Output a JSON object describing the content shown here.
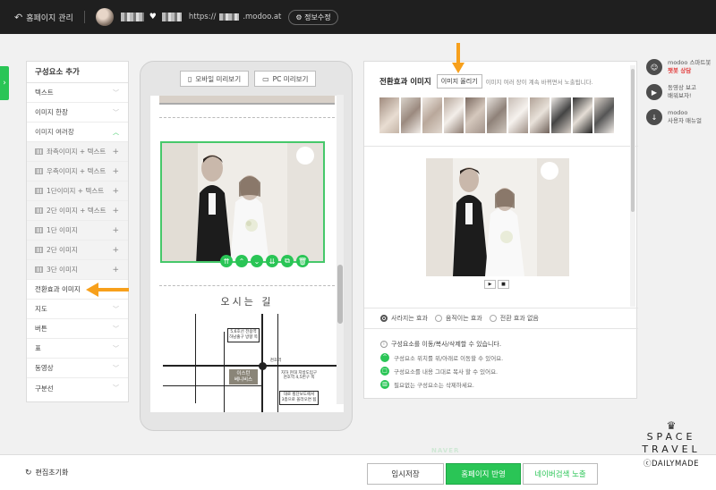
{
  "topbar": {
    "back_label": "홈페이지 관리",
    "url_prefix": "https://",
    "url_suffix": ".modoo.at",
    "edit_label": "정보수정"
  },
  "left_panel": {
    "title": "구성요소 추가",
    "items": [
      {
        "label": "텍스트"
      },
      {
        "label": "이미지 한장"
      },
      {
        "label": "이미지 여러장"
      }
    ],
    "sub_items": [
      {
        "label": "좌측이미지 + 텍스트"
      },
      {
        "label": "우측이미지 + 텍스트"
      },
      {
        "label": "1단이미지 + 텍스트"
      },
      {
        "label": "2단 이미지 + 텍스트"
      },
      {
        "label": "1단 이미지"
      },
      {
        "label": "2단 이미지"
      },
      {
        "label": "3단 이미지"
      }
    ],
    "highlight_item": "전환효과 이미지",
    "more_items": [
      {
        "label": "지도"
      },
      {
        "label": "버튼"
      },
      {
        "label": "표"
      },
      {
        "label": "동영상"
      },
      {
        "label": "구분선"
      }
    ]
  },
  "preview": {
    "mobile_btn": "모바일 미리보기",
    "pc_btn": "PC 미리보기",
    "section_title": "오시는 길",
    "map": {
      "bubble1": "5,6호선 전용역\n하남출구 방향 쪽",
      "station": "천호역",
      "venue_line1": "이스턴",
      "venue_line2": "베니비스",
      "bubble2": "지하 현대 지방도입구\n천호역 4,5번구 쪽",
      "bubble3": "대로 횡단보도에서\n3층으로 올라오면 됨"
    }
  },
  "editor": {
    "title": "전환효과 이미지",
    "upload_btn": "이미지 올리기",
    "description": "이미지 여러 장이 계속 바뀌면서 노출됩니다.",
    "play_btn": "▶",
    "stop_btn": "■",
    "radios": [
      {
        "label": "사라지는 효과",
        "checked": true
      },
      {
        "label": "움직이는 효과",
        "checked": false
      },
      {
        "label": "전환 효과 없음",
        "checked": false
      }
    ],
    "info_title": "구성요소를 이동/복사/삭제할 수 있습니다.",
    "info_rows": [
      {
        "icon": "^",
        "text": "구성요소 위치를 위/아래로 이동할 수 있어요."
      },
      {
        "icon": "□",
        "text": "구성요소를 내용 그대로 복사 할 수 있어요."
      },
      {
        "icon": "▥",
        "text": "필요없는 구성요소는 삭제하세요."
      }
    ]
  },
  "widgets": [
    {
      "title": "modoo 스마트봇",
      "red": "챗봇 상담",
      "icon": "bot-icon"
    },
    {
      "title": "동영상 보고",
      "sub": "배워보자!",
      "icon": "video-icon"
    },
    {
      "title": "modoo",
      "sub": "사용자 매뉴얼",
      "icon": "download-icon"
    }
  ],
  "footer": {
    "reset_label": "편집초기화",
    "temp_save": "임시저장",
    "publish": "홈페이지 반영",
    "naver": "네이버검색 노출",
    "faint_naver": "NAVER"
  },
  "watermark": {
    "line1": "SPACE TRAVEL",
    "line2": "ⓒDAILYMADE"
  },
  "colors": {
    "accent_green": "#2ac556",
    "arrow_orange": "#f7a01c",
    "topbar": "#1f1f1f"
  }
}
